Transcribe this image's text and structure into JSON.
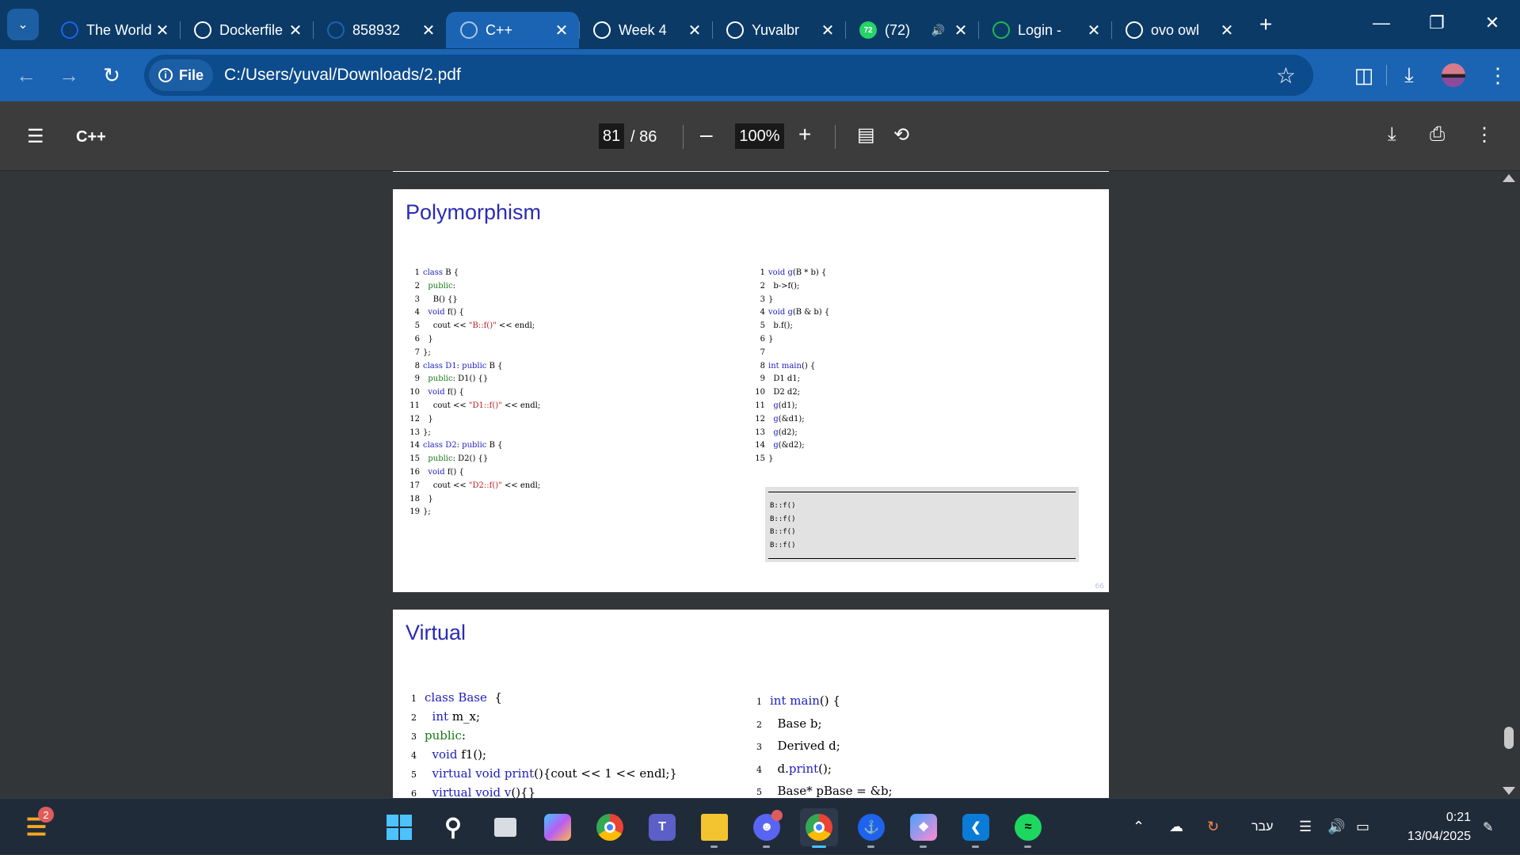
{
  "browser": {
    "tabs": [
      {
        "title": "The World",
        "favicon": "docker-whale-icon",
        "color": "#1d63ed",
        "active": false
      },
      {
        "title": "Dockerfile",
        "favicon": "openai-icon",
        "color": "#ffffff",
        "active": false
      },
      {
        "title": "858932",
        "favicon": "azure-devops-icon",
        "color": "#1b64b3",
        "active": false
      },
      {
        "title": "C++",
        "favicon": "globe-icon",
        "color": "#a9c6ea",
        "active": true
      },
      {
        "title": "Week 4",
        "favicon": "globe-icon",
        "color": "#ffffff",
        "active": false
      },
      {
        "title": "Yuvalbr",
        "favicon": "github-icon",
        "color": "#ffffff",
        "active": false
      },
      {
        "title": "(72)",
        "favicon": "whatsapp-icon",
        "color": "#25d366",
        "active": false,
        "badge": "72"
      },
      {
        "title": "Login -",
        "favicon": "spotify-icon",
        "color": "#1db954",
        "active": false
      },
      {
        "title": "ovo owl",
        "favicon": "google-icon",
        "color": "#ffffff",
        "active": false
      }
    ],
    "address": {
      "scheme_label": "File",
      "url": "C:/Users/yuval/Downloads/2.pdf"
    }
  },
  "pdf": {
    "title": "C++",
    "current_page": "81",
    "total_pages": "/ 86",
    "zoom": "100%"
  },
  "slides": [
    {
      "title": "Polymorphism",
      "code_left": [
        {
          "n": "1",
          "t": "class B {"
        },
        {
          "n": "2",
          "t": "  public:"
        },
        {
          "n": "3",
          "t": "    B() {}"
        },
        {
          "n": "4",
          "t": "  void f() {"
        },
        {
          "n": "5",
          "t": "    cout << \"B::f()\" << endl;"
        },
        {
          "n": "6",
          "t": "  }"
        },
        {
          "n": "7",
          "t": "};"
        },
        {
          "n": "8",
          "t": "class D1: public B {"
        },
        {
          "n": "9",
          "t": "  public: D1() {}"
        },
        {
          "n": "10",
          "t": "  void f() {"
        },
        {
          "n": "11",
          "t": "    cout << \"D1::f()\" << endl;"
        },
        {
          "n": "12",
          "t": "  }"
        },
        {
          "n": "13",
          "t": "};"
        },
        {
          "n": "14",
          "t": "class D2: public B {"
        },
        {
          "n": "15",
          "t": "  public: D2() {}"
        },
        {
          "n": "16",
          "t": "  void f() {"
        },
        {
          "n": "17",
          "t": "    cout << \"D2::f()\" << endl;"
        },
        {
          "n": "18",
          "t": "  }"
        },
        {
          "n": "19",
          "t": "};"
        }
      ],
      "code_right": [
        {
          "n": "1",
          "t": "void g(B * b) {"
        },
        {
          "n": "2",
          "t": "  b->f();"
        },
        {
          "n": "3",
          "t": "}"
        },
        {
          "n": "4",
          "t": "void g(B & b) {"
        },
        {
          "n": "5",
          "t": "  b.f();"
        },
        {
          "n": "6",
          "t": "}"
        },
        {
          "n": "7",
          "t": ""
        },
        {
          "n": "8",
          "t": "int main() {"
        },
        {
          "n": "9",
          "t": "  D1 d1;"
        },
        {
          "n": "10",
          "t": "  D2 d2;"
        },
        {
          "n": "11",
          "t": "  g(d1);"
        },
        {
          "n": "12",
          "t": "  g(&d1);"
        },
        {
          "n": "13",
          "t": "  g(d2);"
        },
        {
          "n": "14",
          "t": "  g(&d2);"
        },
        {
          "n": "15",
          "t": "}"
        }
      ],
      "output": "B::f()\nB::f()\nB::f()\nB::f()",
      "page_number": "66"
    },
    {
      "title": "Virtual",
      "code_left": [
        {
          "n": "1",
          "t": "class Base  {"
        },
        {
          "n": "2",
          "t": "  int m_x;"
        },
        {
          "n": "3",
          "t": "public:"
        },
        {
          "n": "4",
          "t": "  void f1();"
        },
        {
          "n": "5",
          "t": "  virtual void print(){cout << 1 << endl;}"
        },
        {
          "n": "6",
          "t": "  virtual void v(){}"
        }
      ],
      "code_right": [
        {
          "n": "1",
          "t": "int main() {"
        },
        {
          "n": "2",
          "t": "  Base b;"
        },
        {
          "n": "3",
          "t": "  Derived d;"
        },
        {
          "n": "4",
          "t": "  d.print();"
        },
        {
          "n": "5",
          "t": "  Base* pBase = &b;"
        }
      ]
    }
  ],
  "taskbar": {
    "left_badge": "2",
    "apps": [
      "start-icon",
      "search-icon",
      "task-view-icon",
      "copilot-icon",
      "chrome-icon",
      "teams-icon",
      "file-explorer-icon",
      "discord-icon",
      "chrome-profile-icon",
      "docker-icon",
      "paint-icon",
      "vscode-icon",
      "spotify-icon"
    ],
    "language": "עבר",
    "time": "0:21",
    "date": "13/04/2025"
  },
  "colors": {
    "tabstrip": "#0b3a67",
    "toolbar": "#1b64b3",
    "slide_title": "#2b2bb4",
    "keyword": "#2020c0",
    "string": "#c01c1c",
    "access": "#1a7a1a"
  }
}
